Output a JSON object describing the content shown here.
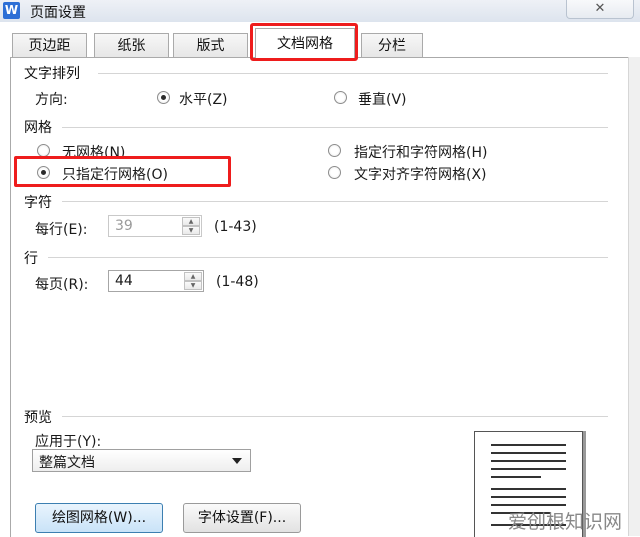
{
  "window": {
    "title": "页面设置",
    "app_icon_letter": "W",
    "close_label": "✕"
  },
  "tabs": [
    {
      "label": "页边距"
    },
    {
      "label": "纸张"
    },
    {
      "label": "版式"
    },
    {
      "label": "文档网格",
      "active": true
    },
    {
      "label": "分栏"
    }
  ],
  "text_layout": {
    "title": "文字排列",
    "direction_label": "方向:",
    "horizontal": "水平(Z)",
    "vertical": "垂直(V)",
    "selected": "horizontal"
  },
  "grid": {
    "title": "网格",
    "none": "无网格(N)",
    "line_only": "只指定行网格(O)",
    "line_and_char": "指定行和字符网格(H)",
    "align_chars": "文字对齐字符网格(X)",
    "selected": "line_only"
  },
  "chars": {
    "title": "字符",
    "per_line_label": "每行(E):",
    "per_line_value": "39",
    "range": "(1-43)",
    "enabled": false
  },
  "lines": {
    "title": "行",
    "per_page_label": "每页(R):",
    "per_page_value": "44",
    "range": "(1-48)"
  },
  "preview": {
    "title": "预览",
    "apply_to_label": "应用于(Y):",
    "apply_to_value": "整篇文档"
  },
  "buttons": {
    "draw_grid": "绘图网格(W)...",
    "font_settings": "字体设置(F)..."
  },
  "watermark": "爱创根知识网",
  "colors": {
    "highlight": "#ee1c1c",
    "accent": "#2d6fd6"
  }
}
